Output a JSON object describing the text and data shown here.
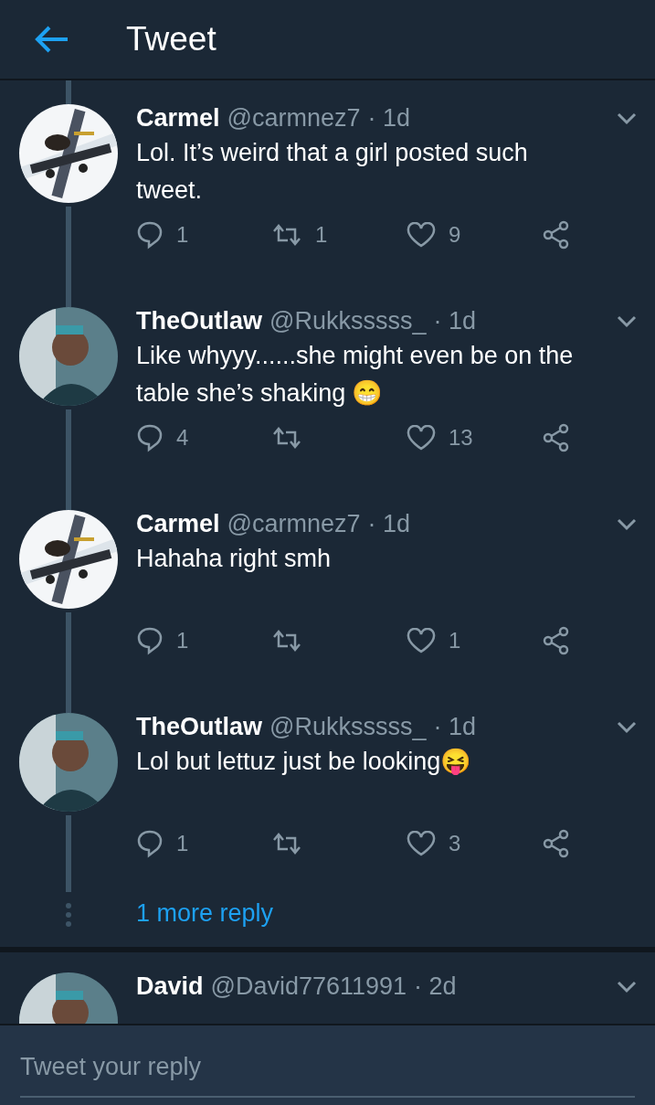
{
  "header": {
    "title": "Tweet"
  },
  "tweets": [
    {
      "name": "Carmel",
      "handle": "@carmnez7",
      "time": "· 1d",
      "text": "Lol. It’s weird that a girl posted such tweet.",
      "threaded": true,
      "replies": "1",
      "retweets": "1",
      "likes": "9"
    },
    {
      "name": "TheOutlaw",
      "handle": "@Rukksssss_",
      "time": "· 1d",
      "text": "Like whyyy......she might even be on the table she’s shaking 😁",
      "threaded": true,
      "replies": "4",
      "likes": "13"
    },
    {
      "name": "Carmel",
      "handle": "@carmnez7",
      "time": "· 1d",
      "text": "Hahaha right smh",
      "threaded": true,
      "replies": "1",
      "likes": "1"
    },
    {
      "name": "TheOutlaw",
      "handle": "@Rukksssss_",
      "time": "· 1d",
      "text": "Lol but lettuz just be looking😝",
      "threaded": true,
      "replies": "1",
      "likes": "3"
    }
  ],
  "more_replies": "1 more reply",
  "next_tweet": {
    "name": "David",
    "handle": "@David77611991",
    "time": "· 2d",
    "threaded": false
  },
  "reply_box": {
    "placeholder": "Tweet your reply"
  }
}
